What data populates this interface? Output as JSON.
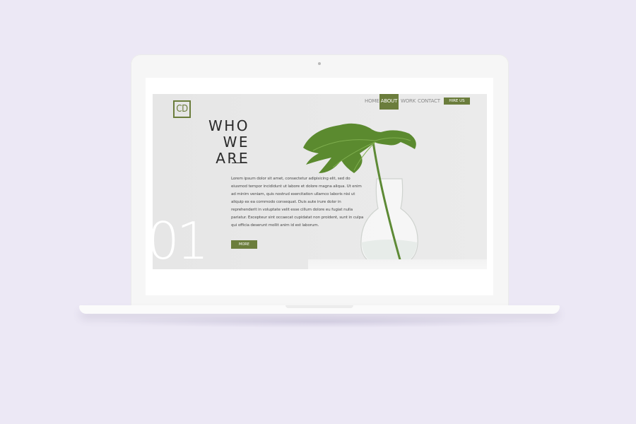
{
  "site": {
    "logo": "CD",
    "nav": [
      {
        "label": "HOME",
        "active": false
      },
      {
        "label": "ABOUT",
        "active": true
      },
      {
        "label": "WORK",
        "active": false
      },
      {
        "label": "CONTACT",
        "active": false
      }
    ],
    "hire_button": "HIRE US",
    "title_line1": "WHO",
    "title_line2": "WE ARE",
    "body": "Lorem ipsum dolor sit amet, consectetur adipisicing elit, sed do eiusmod tempor incididunt ut labore et dolore magna aliqua. Ut enim ad minim veniam, quis nostrud exercitation ullamco laboris nisi ut aliquip ex ea commodo consequat. Duis aute irure dolor in reprehenderit in voluptate velit esse cillum dolore eu fugiat nulla pariatur. Excepteur sint occaecat cupidatat non proident, sunt in culpa qui officia deserunt mollit anim id est laborum.",
    "more_button": "MORE",
    "section_number": "01"
  },
  "colors": {
    "accent": "#6b7d3c",
    "background": "#ece8f5",
    "text": "#2a2a2a"
  }
}
